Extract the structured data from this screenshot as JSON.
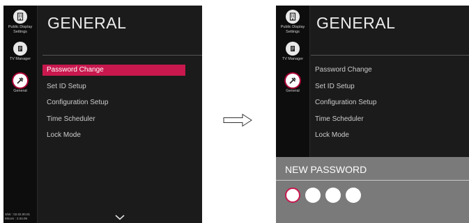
{
  "colors": {
    "accent": "#c8184e",
    "background": "#1b1b1b",
    "panel": "#7a7a7a"
  },
  "sidebar": {
    "items": [
      {
        "label": "Public Display\nSettings",
        "icon": "building-icon"
      },
      {
        "label": "TV Manager",
        "icon": "doc-icon"
      },
      {
        "label": "General",
        "icon": "tools-icon",
        "active": true
      }
    ],
    "fw_line1": "S/W : 02.02.00.01",
    "fw_line2": "Micom : 2.04.06"
  },
  "general": {
    "title": "GENERAL",
    "menu": [
      "Password Change",
      "Set ID Setup",
      "Configuration Setup",
      "Time Scheduler",
      "Lock Mode"
    ],
    "selected_index": 0
  },
  "password": {
    "title": "NEW PASSWORD",
    "digits": 4,
    "active_index": 0
  }
}
